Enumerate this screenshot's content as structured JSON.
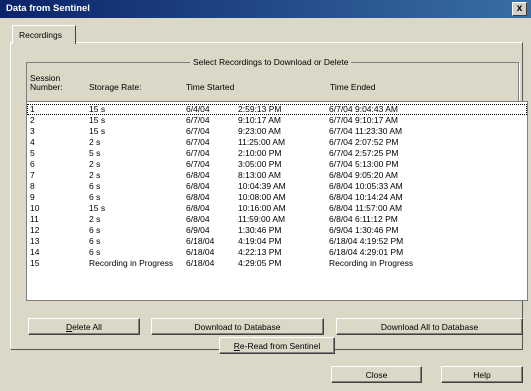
{
  "window": {
    "title": "Data from Sentinel",
    "close_glyph": "x"
  },
  "tab": {
    "label": "Recordings"
  },
  "group": {
    "label": "Select Recordings to Download or Delete"
  },
  "columns": {
    "session_line1": "Session",
    "session_line2": "Number:",
    "storage_rate": "Storage Rate:",
    "time_started": "Time Started",
    "time_ended": "Time Ended"
  },
  "rows": [
    {
      "num": "1",
      "rate": "15 s",
      "date": "6/4/04",
      "time": "2:59:13 PM",
      "ended": "6/7/04 9:04:43 AM"
    },
    {
      "num": "2",
      "rate": "15 s",
      "date": "6/7/04",
      "time": "9:10:17 AM",
      "ended": "6/7/04 9:10:17 AM"
    },
    {
      "num": "3",
      "rate": "15 s",
      "date": "6/7/04",
      "time": "9:23:00 AM",
      "ended": "6/7/04 11:23:30 AM"
    },
    {
      "num": "4",
      "rate": "2 s",
      "date": "6/7/04",
      "time": "11:25:00 AM",
      "ended": "6/7/04 2:07:52 PM"
    },
    {
      "num": "5",
      "rate": "5 s",
      "date": "6/7/04",
      "time": "2:10:00 PM",
      "ended": "6/7/04 2:57:25 PM"
    },
    {
      "num": "6",
      "rate": "2 s",
      "date": "6/7/04",
      "time": "3:05:00 PM",
      "ended": "6/7/04 5:13:00 PM"
    },
    {
      "num": "7",
      "rate": "2 s",
      "date": "6/8/04",
      "time": "8:13:00 AM",
      "ended": "6/8/04 9:05:20 AM"
    },
    {
      "num": "8",
      "rate": "6 s",
      "date": "6/8/04",
      "time": "10:04:39 AM",
      "ended": "6/8/04 10:05:33 AM"
    },
    {
      "num": "9",
      "rate": "6 s",
      "date": "6/8/04",
      "time": "10:08:00 AM",
      "ended": "6/8/04 10:14:24 AM"
    },
    {
      "num": "10",
      "rate": "15 s",
      "date": "6/8/04",
      "time": "10:16:00 AM",
      "ended": "6/8/04 11:57:00 AM"
    },
    {
      "num": "11",
      "rate": "2 s",
      "date": "6/8/04",
      "time": "11:59:00 AM",
      "ended": "6/8/04 6:11:12 PM"
    },
    {
      "num": "12",
      "rate": "6 s",
      "date": "6/9/04",
      "time": "1:30:46 PM",
      "ended": "6/9/04 1:30:46 PM"
    },
    {
      "num": "13",
      "rate": "6 s",
      "date": "6/18/04",
      "time": "4:19:04 PM",
      "ended": "6/18/04 4:19:52 PM"
    },
    {
      "num": "14",
      "rate": "6 s",
      "date": "6/18/04",
      "time": "4:22:13 PM",
      "ended": "6/18/04 4:29:01 PM"
    },
    {
      "num": "15",
      "rate": "Recording in Progress",
      "date": "6/18/04",
      "time": "4:29:05 PM",
      "ended": "Recording in Progress"
    }
  ],
  "buttons": {
    "delete_all": "Delete All",
    "download_db": "Download to Database",
    "download_all_db": "Download All to Database",
    "reread": "Re-Read from Sentinel",
    "close": "Close",
    "help": "Help"
  }
}
